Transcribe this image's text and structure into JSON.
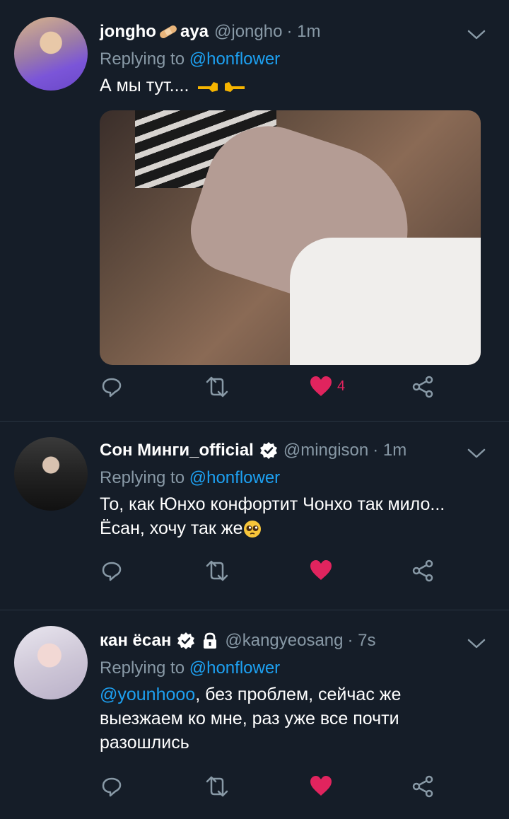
{
  "tweets": [
    {
      "name": "jongho",
      "name_suffix": "aya",
      "handle": "@jongho",
      "time": "· 1m",
      "replying_prefix": "Replying to ",
      "replying_to": "@honflower",
      "text": "А мы тут....",
      "like_count": "4"
    },
    {
      "name": "Сон Минги_official",
      "handle": "@mingison",
      "time": "· 1m",
      "replying_prefix": "Replying to ",
      "replying_to": "@honflower",
      "text_line1": "То, как Юнхо конфортит Чонхо так мило...",
      "text_line2": "Ёсан, хочу так же"
    },
    {
      "name": "кан ёсан",
      "handle": "@kangyeosang",
      "time": "· 7s",
      "replying_prefix": "Replying to ",
      "replying_to": "@honflower",
      "mention": "@younhooo",
      "text_after_mention": ", без проблем, сейчас же",
      "text_line2": "выезжаем ко мне, раз уже все почти",
      "text_line3": "разошлись"
    }
  ],
  "colors": {
    "background": "#151d28",
    "secondary_text": "#8899a6",
    "link": "#1da1f2",
    "like": "#e0245e"
  },
  "icons": [
    "reply-icon",
    "retweet-icon",
    "like-icon",
    "share-icon",
    "chevron-down-icon",
    "verified-badge-icon",
    "lock-icon"
  ]
}
